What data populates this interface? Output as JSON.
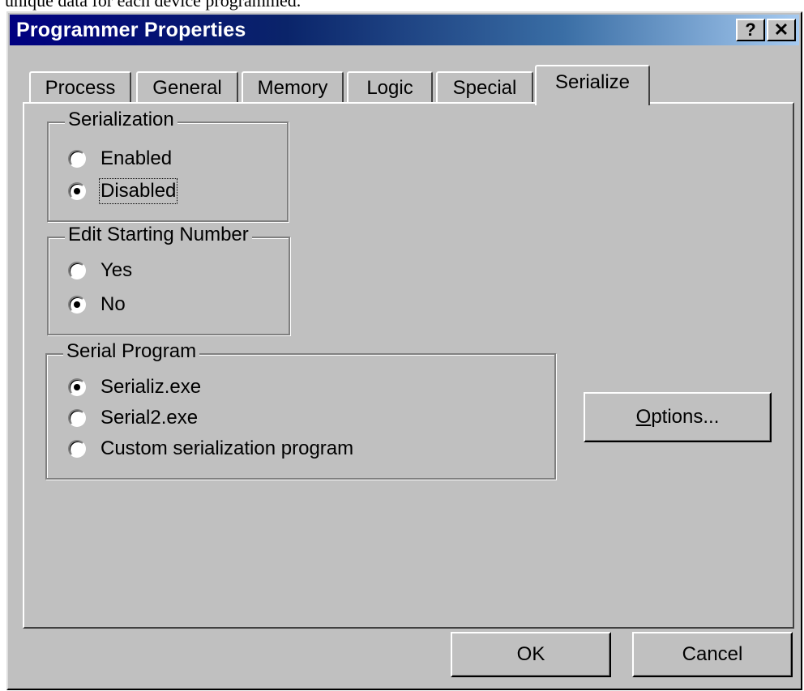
{
  "above_text": "unique data for each device programmed.",
  "window": {
    "title": "Programmer Properties",
    "help_label": "?",
    "close_label": "✕"
  },
  "tabs": [
    {
      "label": "Process"
    },
    {
      "label": "General"
    },
    {
      "label": "Memory"
    },
    {
      "label": "Logic"
    },
    {
      "label": "Special"
    },
    {
      "label": "Serialize",
      "active": true
    }
  ],
  "serialization": {
    "legend": "Serialization",
    "options": [
      {
        "label": "Enabled",
        "checked": false
      },
      {
        "label": "Disabled",
        "checked": true
      }
    ]
  },
  "edit_starting_number": {
    "legend": "Edit Starting Number",
    "options": [
      {
        "label": "Yes",
        "checked": false
      },
      {
        "label": "No",
        "checked": true
      }
    ]
  },
  "serial_program": {
    "legend": "Serial Program",
    "options": [
      {
        "label": "Serializ.exe",
        "checked": true
      },
      {
        "label": "Serial2.exe",
        "checked": false
      },
      {
        "label": "Custom serialization program",
        "checked": false
      }
    ]
  },
  "buttons": {
    "options_mnemonic": "O",
    "options_rest": "ptions...",
    "ok": "OK",
    "cancel": "Cancel"
  }
}
